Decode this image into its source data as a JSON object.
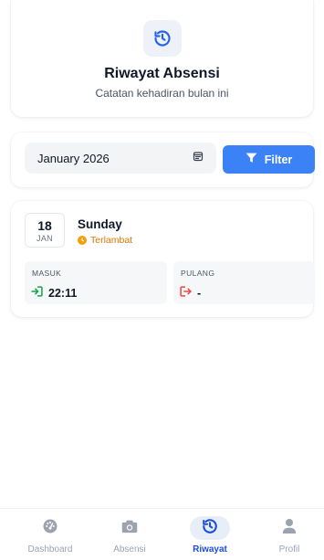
{
  "header": {
    "title": "Riwayat Absensi",
    "subtitle": "Catatan kehadiran bulan ini",
    "icon": "history-icon"
  },
  "filter": {
    "month_value": "January 2026",
    "calendar_icon": "calendar-icon",
    "button_label": "Filter",
    "button_icon": "funnel-icon"
  },
  "records": [
    {
      "day": "18",
      "month": "JAN",
      "weekday": "Sunday",
      "status": "Terlambat",
      "masuk_label": "MASUK",
      "masuk_time": "22:11",
      "pulang_label": "PULANG",
      "pulang_time": "-"
    }
  ],
  "nav": {
    "items": [
      {
        "label": "Dashboard",
        "icon": "speedometer-icon"
      },
      {
        "label": "Absensi",
        "icon": "camera-icon"
      },
      {
        "label": "Riwayat",
        "icon": "history-icon",
        "active": true
      },
      {
        "label": "Profil",
        "icon": "user-icon"
      }
    ]
  },
  "colors": {
    "primary": "#3b82f6",
    "active_nav": "#1d4ed8",
    "warning": "#f59e0b",
    "checkin": "#16a34a",
    "checkout": "#ef4444"
  }
}
